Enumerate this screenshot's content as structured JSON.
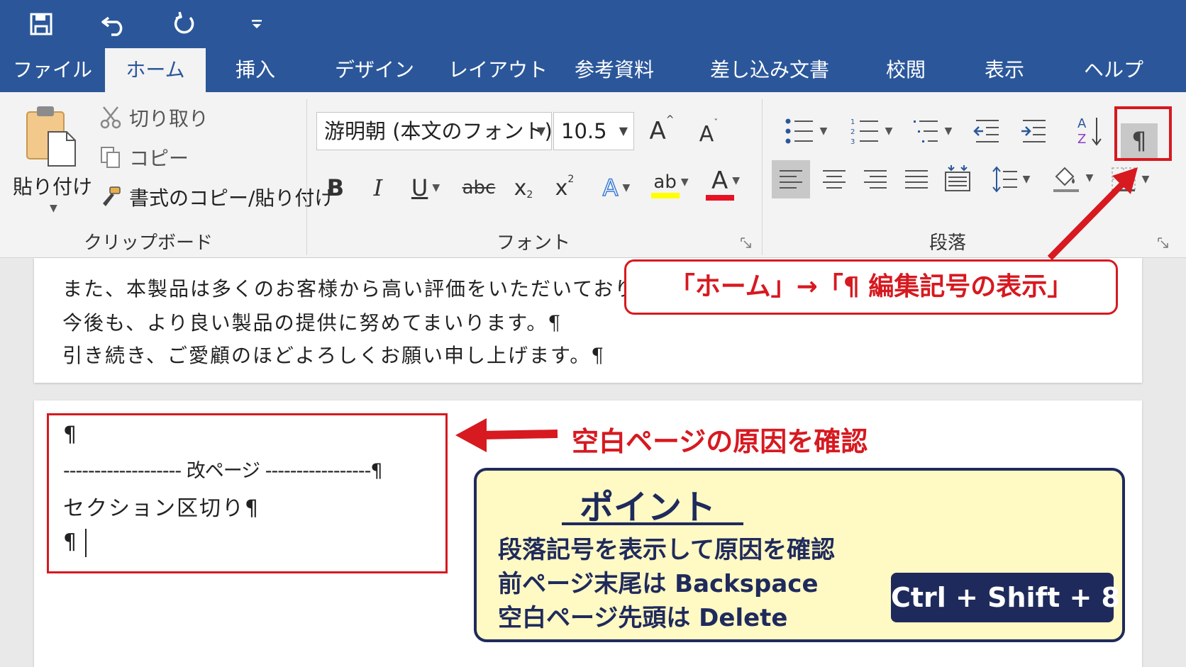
{
  "quick_access": {
    "save_icon": "save-icon",
    "undo_icon": "undo-icon",
    "redo_icon": "redo-icon",
    "customize_icon": "customize-qat-icon"
  },
  "tabs": [
    {
      "label": "ファイル"
    },
    {
      "label": "ホーム"
    },
    {
      "label": "挿入"
    },
    {
      "label": "デザイン"
    },
    {
      "label": "レイアウト"
    },
    {
      "label": "参考資料"
    },
    {
      "label": "差し込み文書"
    },
    {
      "label": "校閲"
    },
    {
      "label": "表示"
    },
    {
      "label": "ヘルプ"
    }
  ],
  "ribbon": {
    "clipboard": {
      "label": "クリップボード",
      "paste": "貼り付け",
      "cut": "切り取り",
      "copy": "コピー",
      "format_painter": "書式のコピー/貼り付け"
    },
    "font": {
      "label": "フォント",
      "font_name": "游明朝 (本文のフォント)",
      "font_size": "10.5",
      "bold": "B",
      "italic": "I",
      "underline": "U",
      "strikethrough": "abc",
      "subscript_base": "x",
      "subscript_mark": "2",
      "superscript_base": "x",
      "superscript_mark": "2",
      "grow_font": "A",
      "shrink_font": "A",
      "text_effects": "A",
      "highlight": "ab",
      "font_color": "A",
      "highlight_color": "#ffff00",
      "font_color_value": "#e81123"
    },
    "paragraph": {
      "label": "段落",
      "pilcrow": "¶"
    }
  },
  "document": {
    "page1_lines": [
      "また、本製品は多くのお客様から高い評価をいただいており",
      "今後も、より良い製品の提供に努めてまいります。¶",
      "引き続き、ご愛顧のほどよろしくお願い申し上げます。¶"
    ],
    "page2": {
      "line1": "¶",
      "page_break": "------------------- 改ページ -----------------¶",
      "section_break": "セクション区切り¶",
      "line4": "¶"
    }
  },
  "annotations": {
    "top_callout": "「ホーム」→「¶ 編集記号の表示」",
    "cause": "空白ページの原因を確認",
    "point_title": "ポイント",
    "point_lines": [
      "段落記号を表示して原因を確認",
      "前ページ末尾は Backspace",
      "空白ページ先頭は Delete"
    ],
    "shortcut": "Ctrl + Shift + 8",
    "accent_color": "#d71920",
    "navy_color": "#1f2a5c",
    "ribbon_blue": "#2b579a"
  }
}
